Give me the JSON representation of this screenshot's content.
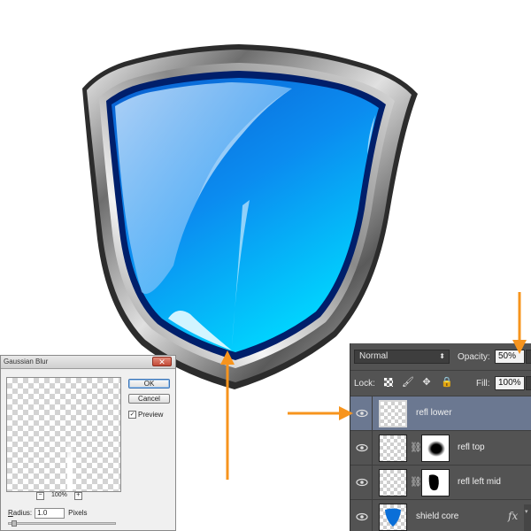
{
  "canvas": {
    "shield_colors": {
      "frame_dark": "#2b2b2b",
      "frame_light": "#e8e8e8",
      "blue_deep": "#002a7a",
      "blue_mid": "#0a7fe6",
      "blue_light": "#5ab7ff",
      "cyan": "#00d8ff"
    },
    "annotation_color": "#f7941d"
  },
  "gaussian_blur": {
    "title": "Gaussian Blur",
    "close_icon": "close-icon",
    "ok_label": "OK",
    "cancel_label": "Cancel",
    "preview_label": "Preview",
    "preview_checked": "✓",
    "zoom_out": "−",
    "zoom_level": "100%",
    "zoom_in": "+",
    "radius_label_first": "R",
    "radius_label_rest": "adius:",
    "radius_value": "1.0",
    "radius_unit": "Pixels"
  },
  "layers_panel": {
    "blend_mode": "Normal",
    "opacity_label": "Opacity:",
    "opacity_value": "50%",
    "lock_label": "Lock:",
    "fill_label": "Fill:",
    "fill_value": "100%",
    "layers": [
      {
        "name": "refl lower",
        "selected": true,
        "has_mask": false
      },
      {
        "name": "refl top",
        "selected": false,
        "has_mask": true
      },
      {
        "name": "refl left mid",
        "selected": false,
        "has_mask": true
      },
      {
        "name": "shield core",
        "selected": false,
        "has_mask": false,
        "effects": "fx"
      }
    ]
  }
}
